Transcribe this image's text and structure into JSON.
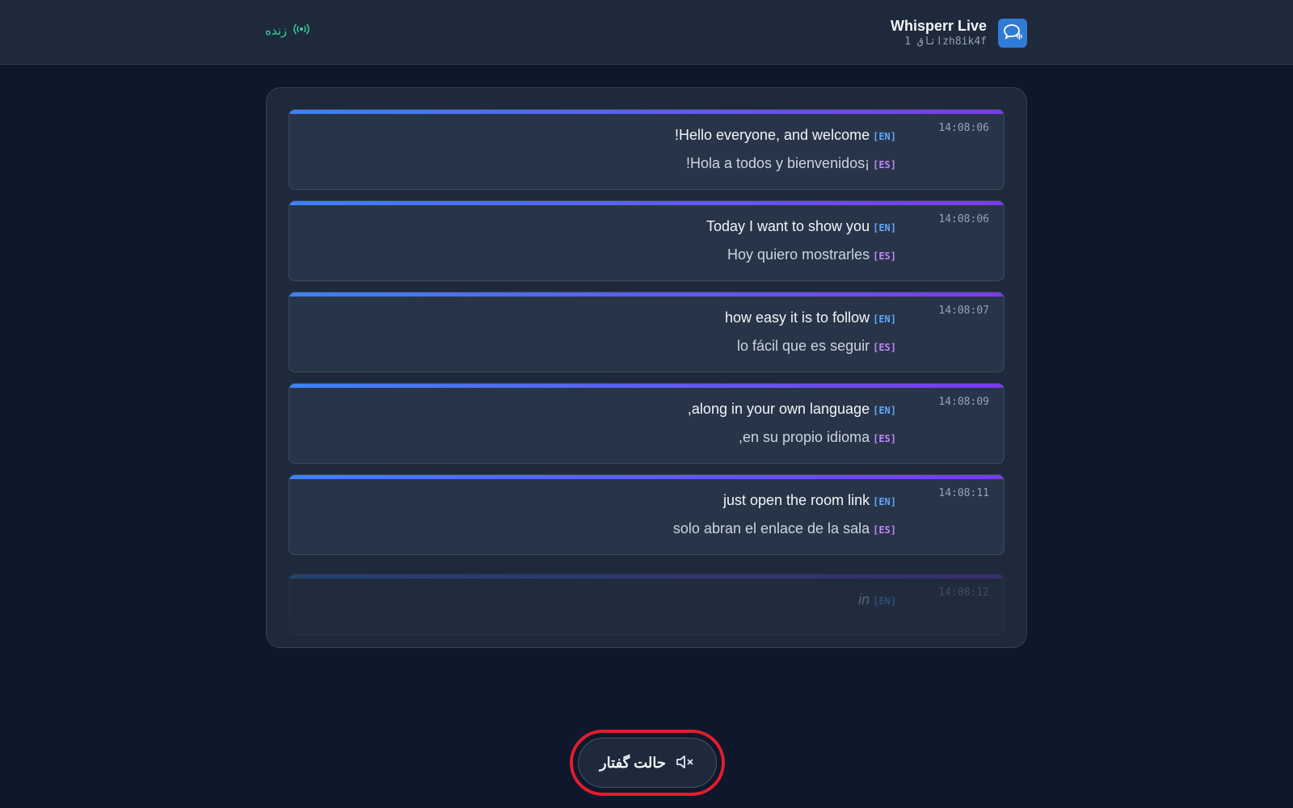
{
  "header": {
    "title": "Whisperr Live",
    "room": "اتاق 1zh8ik4f",
    "live_label": "زنده",
    "colors": {
      "background": "#1e293b",
      "logo": "#2f7bd6",
      "live": "#34d399"
    }
  },
  "transcript": {
    "entries": [
      {
        "time": "14:08:06",
        "source_lang": "[EN]",
        "source_text": "!Hello everyone, and welcome",
        "target_lang": "[ES]",
        "target_text": "!Hola a todos y bienvenidos¡"
      },
      {
        "time": "14:08:06",
        "source_lang": "[EN]",
        "source_text": "Today I want to show you",
        "target_lang": "[ES]",
        "target_text": "Hoy quiero mostrarles"
      },
      {
        "time": "14:08:07",
        "source_lang": "[EN]",
        "source_text": "how easy it is to follow",
        "target_lang": "[ES]",
        "target_text": "lo fácil que es seguir"
      },
      {
        "time": "14:08:09",
        "source_lang": "[EN]",
        "source_text": ",along in your own language",
        "target_lang": "[ES]",
        "target_text": ",en su propio idioma"
      },
      {
        "time": "14:08:11",
        "source_lang": "[EN]",
        "source_text": "just open the room link",
        "target_lang": "[ES]",
        "target_text": "solo abran el enlace de la sala"
      },
      {
        "time": "14:08:12",
        "source_lang": "[EN]",
        "source_text": "in"
      }
    ],
    "colors": {
      "en_tag": "#60a5fa",
      "es_tag": "#c084fc",
      "accent_start": "#3b82f6",
      "accent_end": "#7c3aed"
    }
  },
  "speak_button": {
    "label": "حالت گفتار",
    "icon": "speaker-muted-icon",
    "highlight_color": "#e11d2f"
  }
}
